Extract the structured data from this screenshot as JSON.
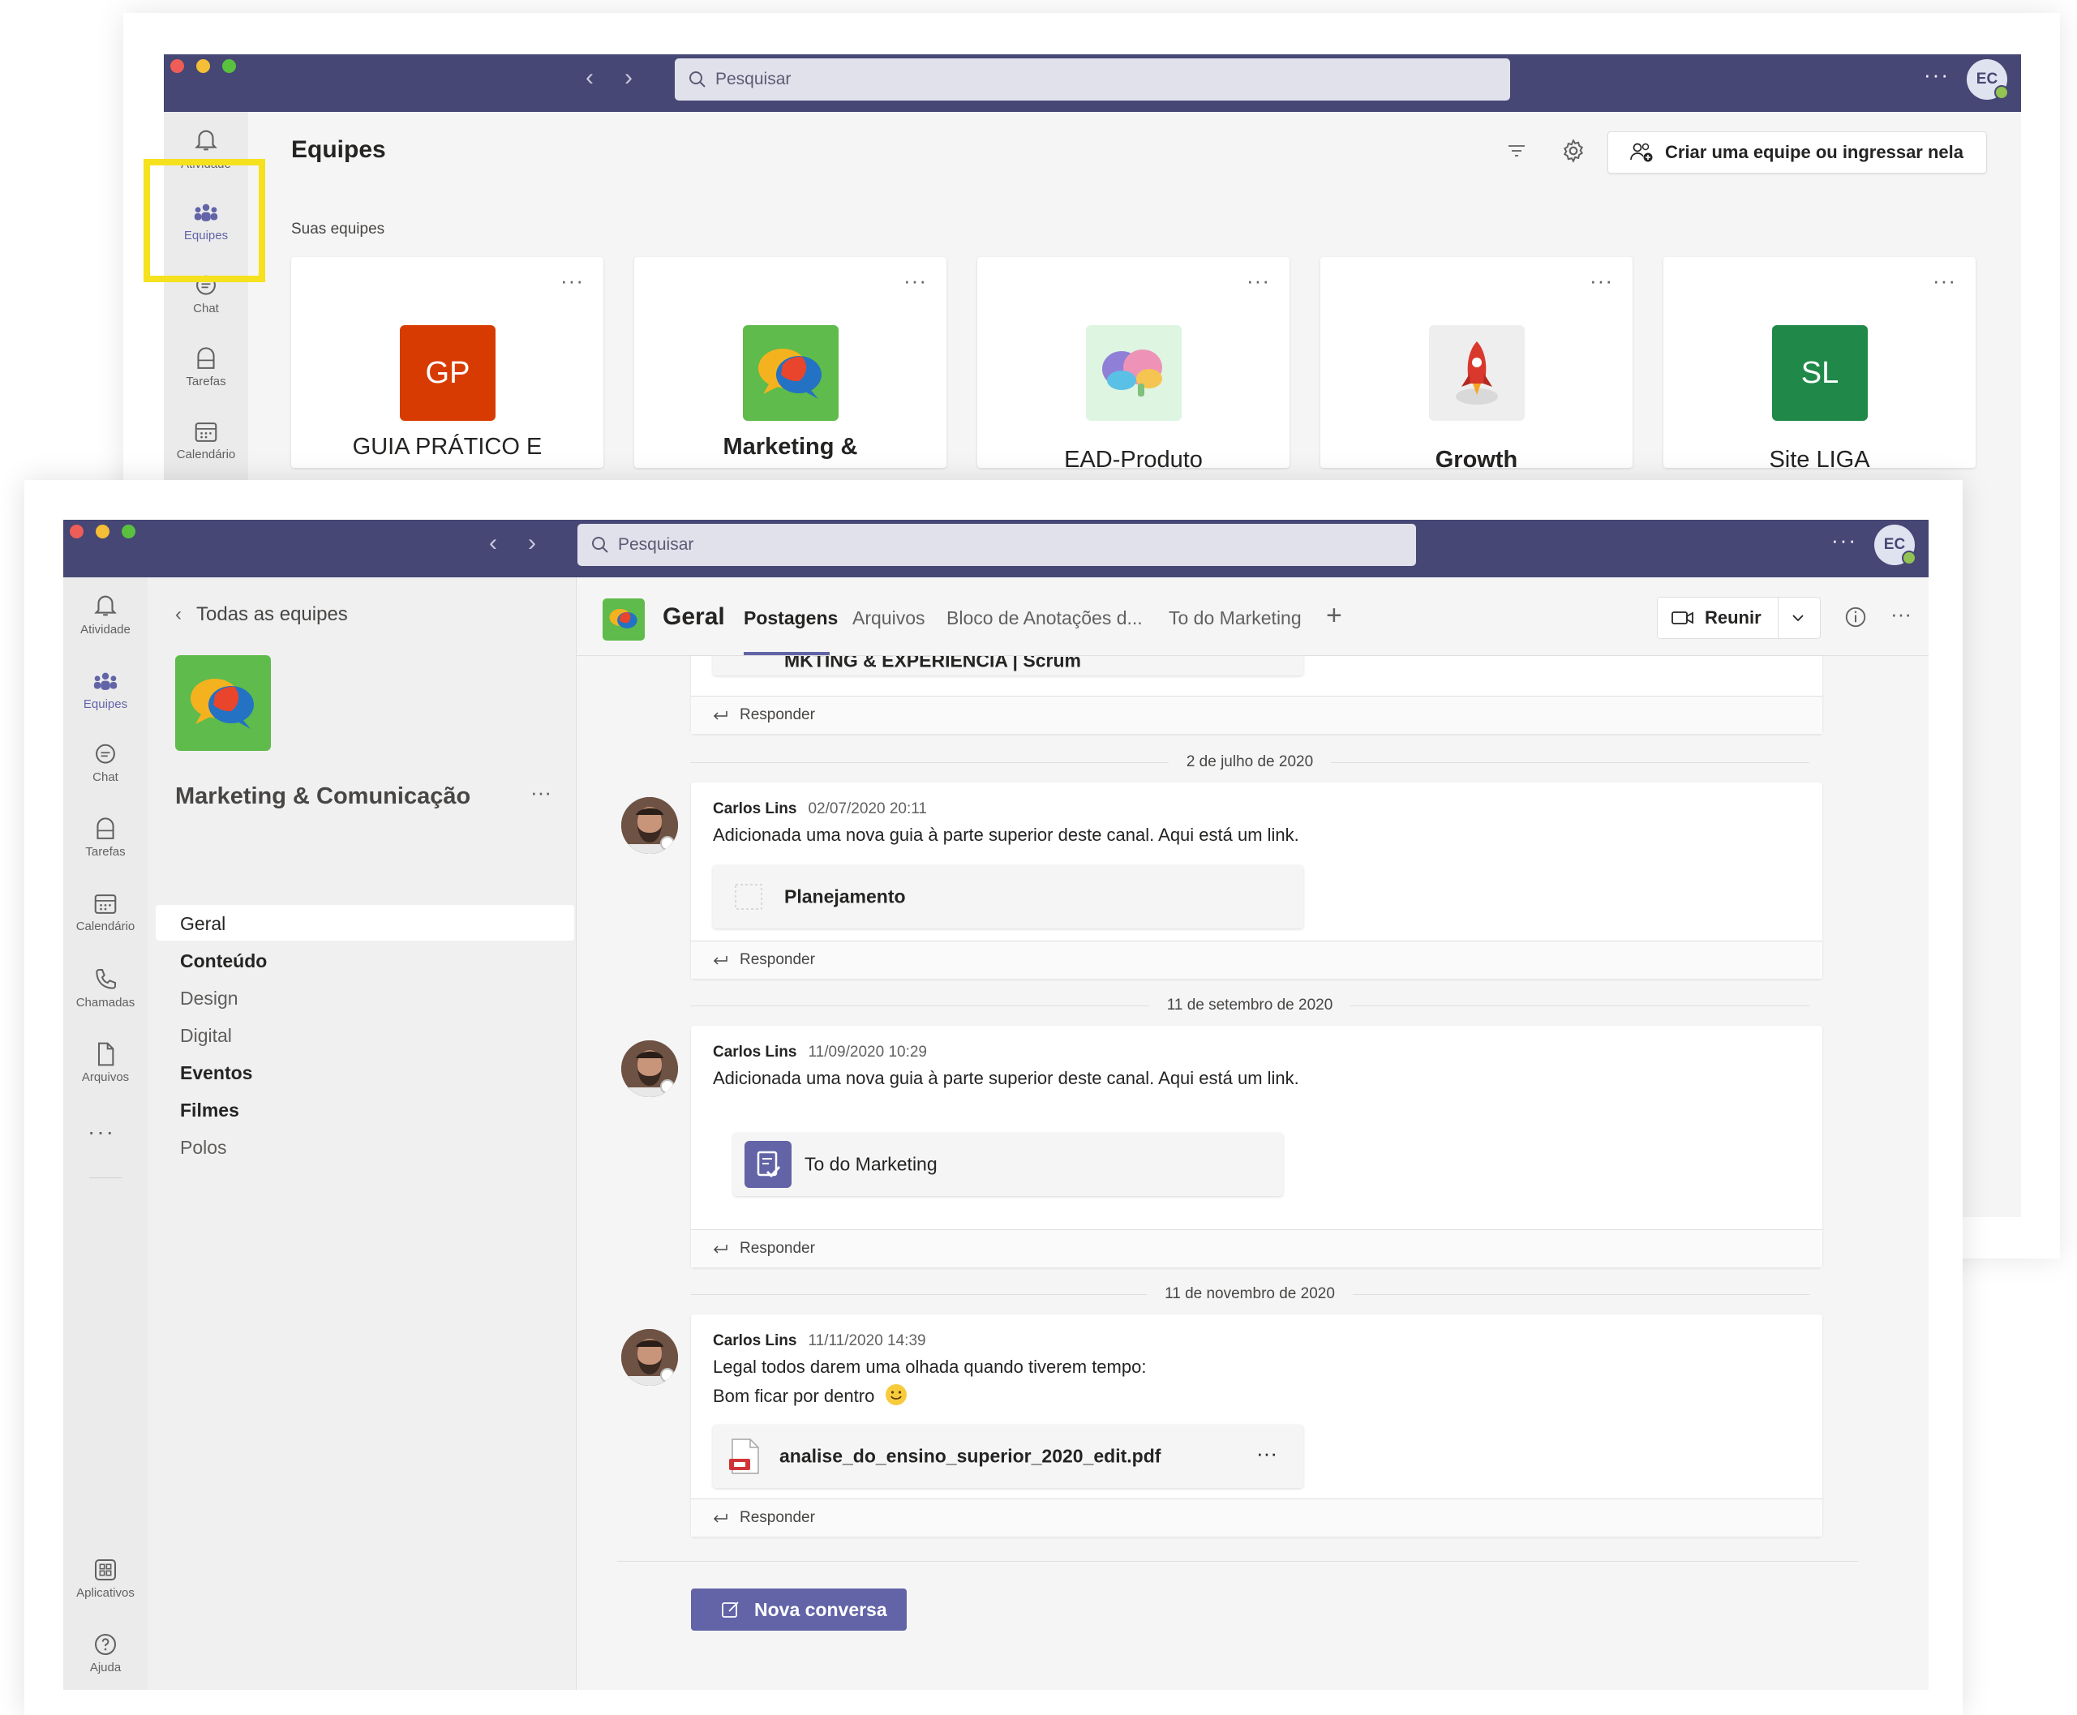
{
  "back_window": {
    "search_placeholder": "Pesquisar",
    "avatar_initials": "EC",
    "rail": {
      "activity_label": "Atividade",
      "teams_label": "Equipes",
      "chat_label": "Chat",
      "tasks_label": "Tarefas",
      "calendar_label": "Calendário"
    },
    "page_title": "Equipes",
    "create_team_label": "Criar uma equipe ou ingressar nela",
    "section_label": "Suas equipes",
    "teams": [
      {
        "name": "GUIA PRÁTICO E",
        "initials": "GP",
        "color": "#d83b01"
      },
      {
        "name": "Marketing &",
        "initials": "",
        "color": "#5fbb4b"
      },
      {
        "name": "EAD-Produto",
        "initials": "",
        "color": "#def5e1"
      },
      {
        "name": "Growth",
        "initials": "",
        "color": "#eeeeee"
      },
      {
        "name": "Site LIGA",
        "initials": "SL",
        "color": "#20894a"
      }
    ],
    "highlight_color": "#f5e11e"
  },
  "front_window": {
    "search_placeholder": "Pesquisar",
    "avatar_initials": "EC",
    "rail": {
      "activity_label": "Atividade",
      "teams_label": "Equipes",
      "chat_label": "Chat",
      "tasks_label": "Tarefas",
      "calendar_label": "Calendário",
      "calls_label": "Chamadas",
      "files_label": "Arquivos",
      "apps_label": "Aplicativos",
      "help_label": "Ajuda"
    },
    "back_link": "Todas as equipes",
    "team_name": "Marketing & Comunicação",
    "channels": [
      {
        "name": "Geral",
        "bold": false,
        "selected": true
      },
      {
        "name": "Conteúdo",
        "bold": true
      },
      {
        "name": "Design",
        "bold": false
      },
      {
        "name": "Digital",
        "bold": false
      },
      {
        "name": "Eventos",
        "bold": true
      },
      {
        "name": "Filmes",
        "bold": true
      },
      {
        "name": "Polos",
        "bold": false
      }
    ],
    "channel_title": "Geral",
    "tabs": [
      "Postagens",
      "Arquivos",
      "Bloco de Anotações d...",
      "To do Marketing"
    ],
    "meet_label": "Reunir",
    "first_post_card": "MKTING & EXPERIÊNCIA | Scrum",
    "reply_label": "Responder",
    "posts": [
      {
        "date": "2 de julho de 2020",
        "author": "Carlos Lins",
        "time": "02/07/2020 20:11",
        "message": "Adicionada uma nova guia à parte superior deste canal. Aqui está um link.",
        "card": "Planejamento"
      },
      {
        "date": "11 de setembro de 2020",
        "author": "Carlos Lins",
        "time": "11/09/2020 10:29",
        "message": "Adicionada uma nova guia à parte superior deste canal. Aqui está um link.",
        "card": "To do Marketing"
      },
      {
        "date": "11 de novembro de 2020",
        "author": "Carlos Lins",
        "time": "11/11/2020 14:39",
        "message_line1": "Legal todos darem uma olhada quando tiverem tempo:",
        "message_line2": "Bom ficar por dentro",
        "card": "analise_do_ensino_superior_2020_edit.pdf"
      }
    ],
    "new_conversation_label": "Nova conversa"
  },
  "colors": {
    "titlebar": "#464775",
    "accent": "#6264a7"
  }
}
